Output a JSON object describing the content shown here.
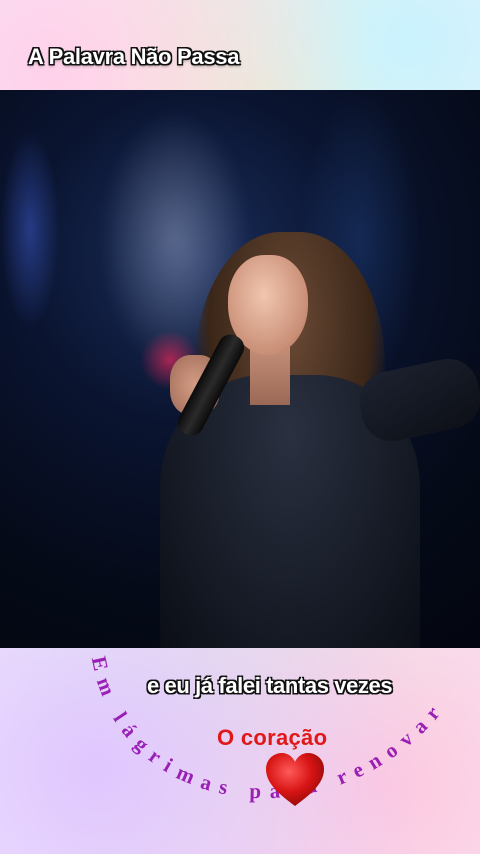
{
  "overlay": {
    "title": "A Palavra Não Passa",
    "subtitle": "e eu já falei tantas vezes",
    "highlight": "O coração",
    "arc_text": "Em lágrimas para renovar",
    "heart_icon": "heart-icon",
    "colors": {
      "arc_text": "#9a1fb5",
      "highlight": "#e01818",
      "heart": "#d81414"
    }
  }
}
